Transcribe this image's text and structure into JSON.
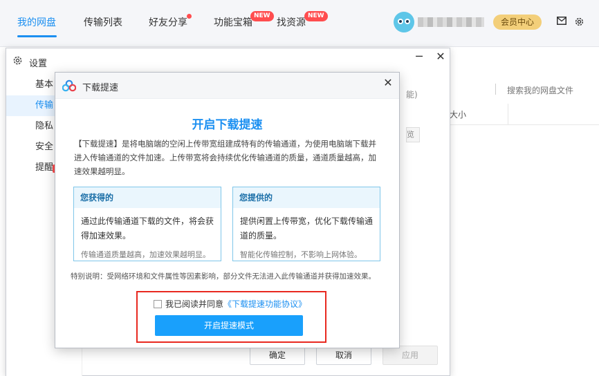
{
  "topbar": {
    "tabs": [
      {
        "label": "我的网盘"
      },
      {
        "label": "传输列表"
      },
      {
        "label": "好友分享"
      },
      {
        "label": "功能宝箱"
      },
      {
        "label": "找资源"
      }
    ],
    "active_tab": "我的网盘",
    "new_badge": "NEW",
    "vip_label": "会员中心",
    "icons": [
      "mail-icon",
      "settings-icon"
    ]
  },
  "background": {
    "search_placeholder": "搜索我的网盘文件",
    "size_column": "大小",
    "partial_text": "能)",
    "partial_button": "览"
  },
  "settings": {
    "title": "设置",
    "sidebar": [
      {
        "label": "基本"
      },
      {
        "label": "传输"
      },
      {
        "label": "隐私"
      },
      {
        "label": "安全"
      },
      {
        "label": "提醒"
      }
    ],
    "active_item": "传输",
    "footer": {
      "ok": "确定",
      "cancel": "取消",
      "apply": "应用"
    }
  },
  "dialog": {
    "title": "下载提速",
    "heading": "开启下载提速",
    "description": "【下载提速】是将电脑端的空闲上传带宽组建成特有的传输通道，为使用电脑端下载并进入传输通道的文件加速。上传带宽将会持续优化传输通道的质量，通道质量越高，加速效果越明显。",
    "cards": [
      {
        "title": "您获得的",
        "body": "通过此传输通道下载的文件，将会获得加速效果。",
        "note": "传输通道质量越高，加速效果越明显。"
      },
      {
        "title": "您提供的",
        "body": "提供闲置上传带宽，优化下载传输通道的质量。",
        "note": "智能化传输控制，不影响上网体验。"
      }
    ],
    "special_note": "特别说明：受网络环境和文件属性等因素影响，部分文件无法进入此传输通道并获得加速效果。",
    "agree_prefix": "我已阅读并同意",
    "agree_link": "《下载提速功能协议》",
    "agree_checked": false,
    "primary_button": "开启提速模式",
    "highlight_color": "#e8281f",
    "accent_color": "#1b8ff1"
  }
}
